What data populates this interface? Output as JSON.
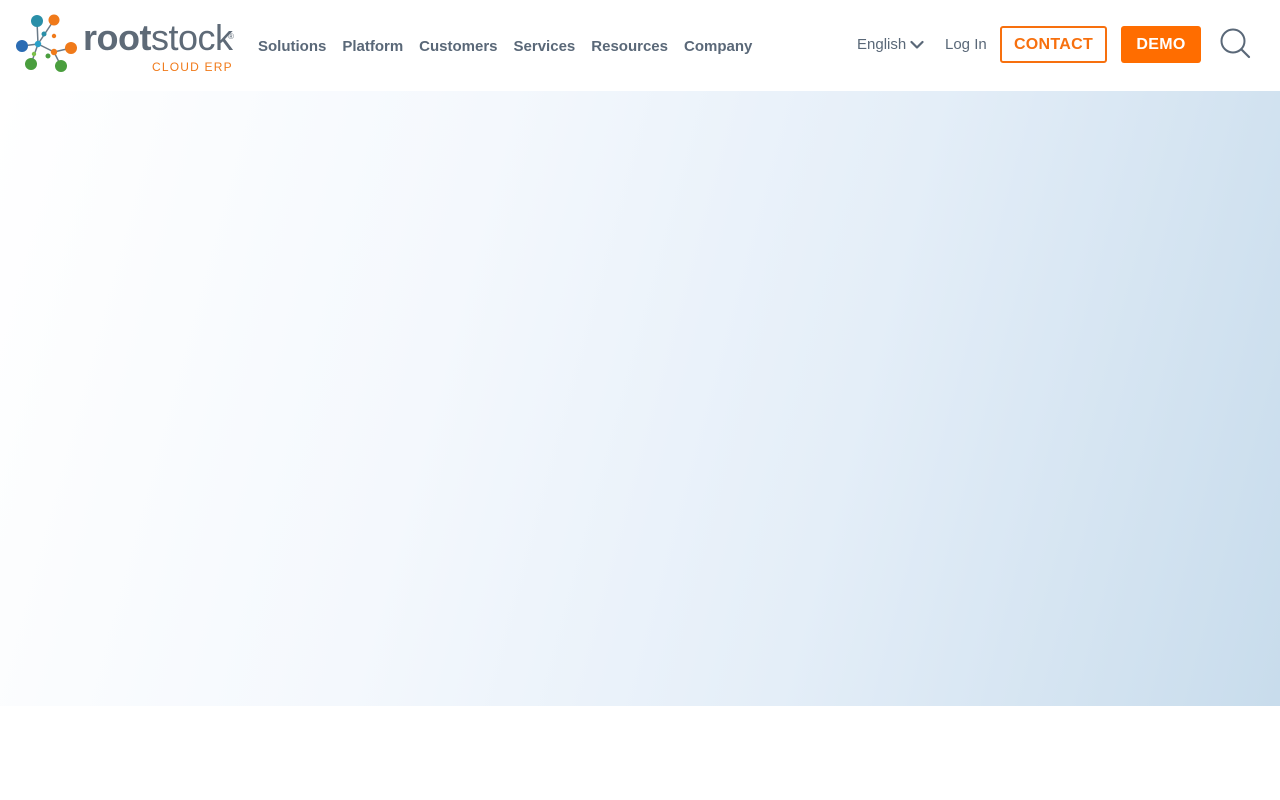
{
  "brand": {
    "wordmark_bold": "root",
    "wordmark_light": "stock",
    "registered": "®",
    "subtitle": "CLOUD ERP",
    "colors": {
      "orange": "#f7700e",
      "gray": "#5e6a77",
      "teal": "#2a8fa8",
      "blue": "#2b6cb3",
      "green": "#4a9e3e"
    }
  },
  "nav": {
    "items": [
      {
        "label": "Solutions"
      },
      {
        "label": "Platform"
      },
      {
        "label": "Customers"
      },
      {
        "label": "Services"
      },
      {
        "label": "Resources"
      },
      {
        "label": "Company"
      }
    ]
  },
  "utility": {
    "language": "English",
    "login": "Log In",
    "contact": "CONTACT",
    "demo": "DEMO",
    "search_icon": "search-icon",
    "chevron_icon": "chevron-down-icon"
  },
  "hero": {
    "gradient_start": "#ffffff",
    "gradient_end": "#c8dcec"
  }
}
